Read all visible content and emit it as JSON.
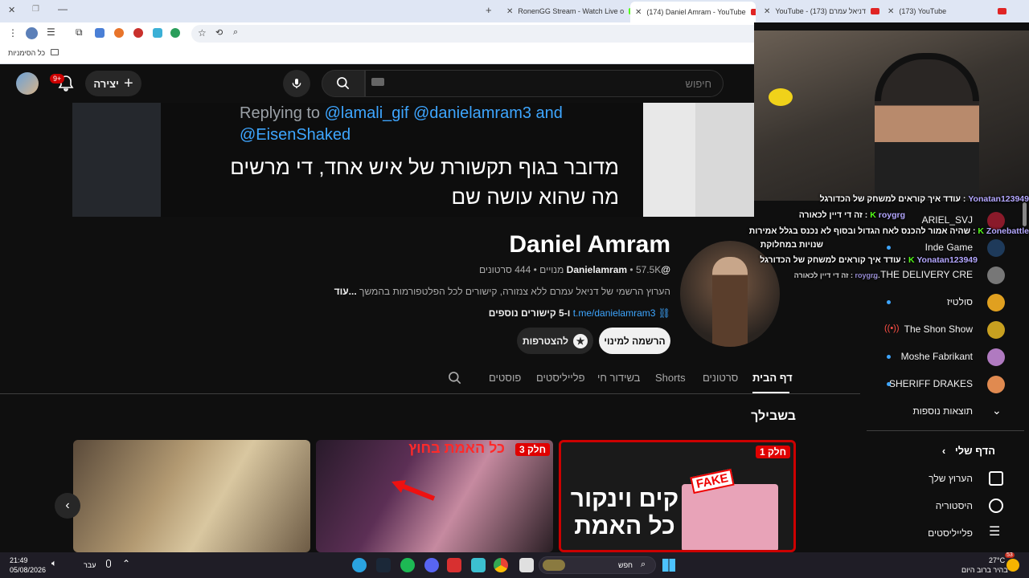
{
  "browser": {
    "tabs": [
      {
        "title": "RonenGG Stream - Watch Live o",
        "favicon": "kick-icon"
      },
      {
        "title": "(174) Daniel Amram - YouTube",
        "favicon": "youtube-icon",
        "active": true
      },
      {
        "title": "YouTube - דניאל עמרם (173)",
        "favicon": "youtube-icon"
      },
      {
        "title": "(173) YouTube",
        "favicon": "youtube-icon"
      }
    ],
    "bookmarks_folder": "כל הסימניות"
  },
  "header": {
    "search_placeholder": "חיפוש",
    "create_label": "יצירה",
    "notifications_badge": "9+"
  },
  "banner": {
    "reply_prefix": "Replying to",
    "reply_handles": "@lamali_gif @danielamram3 and",
    "reply_handles_2": "@EisenShaked",
    "text_line1": "מדובר בגוף תקשורת של איש אחד, די מרשים",
    "text_line2": "מה שהוא עושה שם"
  },
  "channel": {
    "name": "Daniel Amram",
    "handle": "@Danielamram",
    "subscribers": "57.5K מנויים",
    "videos": "444 סרטונים",
    "description": "הערוץ הרשמי של דניאל עמרם ללא צנזורה, קישורים לכל הפלטפורמות בהמשך",
    "more": "...עוד",
    "link": "t.me/danielamram3",
    "more_links": "ו-5 קישורים נוספים",
    "subscribe_label": "הרשמה למינוי",
    "join_label": "להצטרפות"
  },
  "tabs": [
    "דף הבית",
    "סרטונים",
    "Shorts",
    "בשידור חי",
    "פלייליסטים",
    "פוסטים"
  ],
  "section": {
    "title": "בשבילך",
    "thumbnails": [
      {
        "title": "",
        "badge": ""
      },
      {
        "title": "כל האמת בחוץ",
        "badge": "חלק 3"
      },
      {
        "title": "קים וינקור כל האמת",
        "badge": "חלק 1",
        "stamp": "FAKE"
      }
    ]
  },
  "sidebar": {
    "subscriptions": [
      {
        "label": "ARIEL_SVJ",
        "indicator": "none"
      },
      {
        "label": "Inde Game",
        "indicator": "dot"
      },
      {
        "label": "THE DELIVERY CRE...",
        "indicator": "none"
      },
      {
        "label": "סולטיז",
        "indicator": "dot"
      },
      {
        "label": "The Shon Show",
        "indicator": "live"
      },
      {
        "label": "Moshe Fabrikant",
        "indicator": "dot"
      },
      {
        "label": "SHERIFF DRAKES",
        "indicator": "dot"
      },
      {
        "label": "תוצאות נוספות",
        "indicator": "none"
      }
    ],
    "my_page_header": "הדף שלי",
    "my_page_items": [
      "הערוץ שלך",
      "היסטוריה",
      "פלייליסטים"
    ]
  },
  "chat": [
    {
      "user": "Yonatan123949",
      "message": "עודד איך קוראים למשחק של הכדורגל"
    },
    {
      "user": "roygrg",
      "message": "זה די דיין לכאורה"
    },
    {
      "user": "Zonebattle",
      "message": "שהיה אמור להכנס לאח הגדול ובסוף לא נכנס בגלל אמירות"
    },
    {
      "user": "",
      "message": "שנויות במחלוקת"
    },
    {
      "user": "Yonatan123949",
      "message": "עודד איך קוראים למשחק של הכדורגל"
    },
    {
      "user": "roygrg",
      "message": "זה די דיין לכאורה"
    }
  ],
  "taskbar": {
    "time": "21:49",
    "date": "05/08/2026",
    "language": "עבר",
    "search_label": "חפש",
    "weather_temp": "27°C",
    "weather_desc": "בהיר ברוב היום",
    "weather_badge": "53"
  }
}
